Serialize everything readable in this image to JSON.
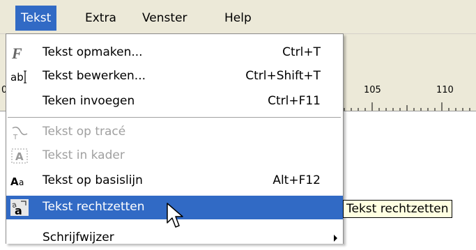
{
  "menubar": {
    "items": [
      {
        "label": "Tekst",
        "active": true
      },
      {
        "label": "Extra",
        "active": false
      },
      {
        "label": "Venster",
        "active": false
      },
      {
        "label": "Help",
        "active": false
      }
    ]
  },
  "ruler": {
    "left_label": "0",
    "label_105": "105",
    "label_110": "110"
  },
  "menu": {
    "items": [
      {
        "label": "Tekst opmaken...",
        "shortcut": "Ctrl+T",
        "icon": "text-format-icon",
        "enabled": true
      },
      {
        "label": "Tekst bewerken...",
        "shortcut": "Ctrl+Shift+T",
        "icon": "text-edit-icon",
        "enabled": true
      },
      {
        "label": "Teken invoegen",
        "shortcut": "Ctrl+F11",
        "icon": "",
        "enabled": true
      },
      {
        "label": "Tekst op tracé",
        "shortcut": "",
        "icon": "text-on-path-icon",
        "enabled": false
      },
      {
        "label": "Tekst in kader",
        "shortcut": "",
        "icon": "text-in-frame-icon",
        "enabled": false
      },
      {
        "label": "Tekst op basislijn",
        "shortcut": "Alt+F12",
        "icon": "text-baseline-icon",
        "enabled": true
      },
      {
        "label": "Tekst rechtzetten",
        "shortcut": "",
        "icon": "straighten-text-icon",
        "enabled": true,
        "highlighted": true
      },
      {
        "label": "Schrijfwijzer",
        "shortcut": "",
        "icon": "",
        "enabled": true,
        "submenu": true
      }
    ]
  },
  "tooltip": {
    "text": "Tekst rechtzetten"
  },
  "colors": {
    "highlight": "#316ac5",
    "menubar_bg": "#ece9d8",
    "disabled_text": "#a0a0a0",
    "tooltip_bg": "#ffffe1"
  }
}
